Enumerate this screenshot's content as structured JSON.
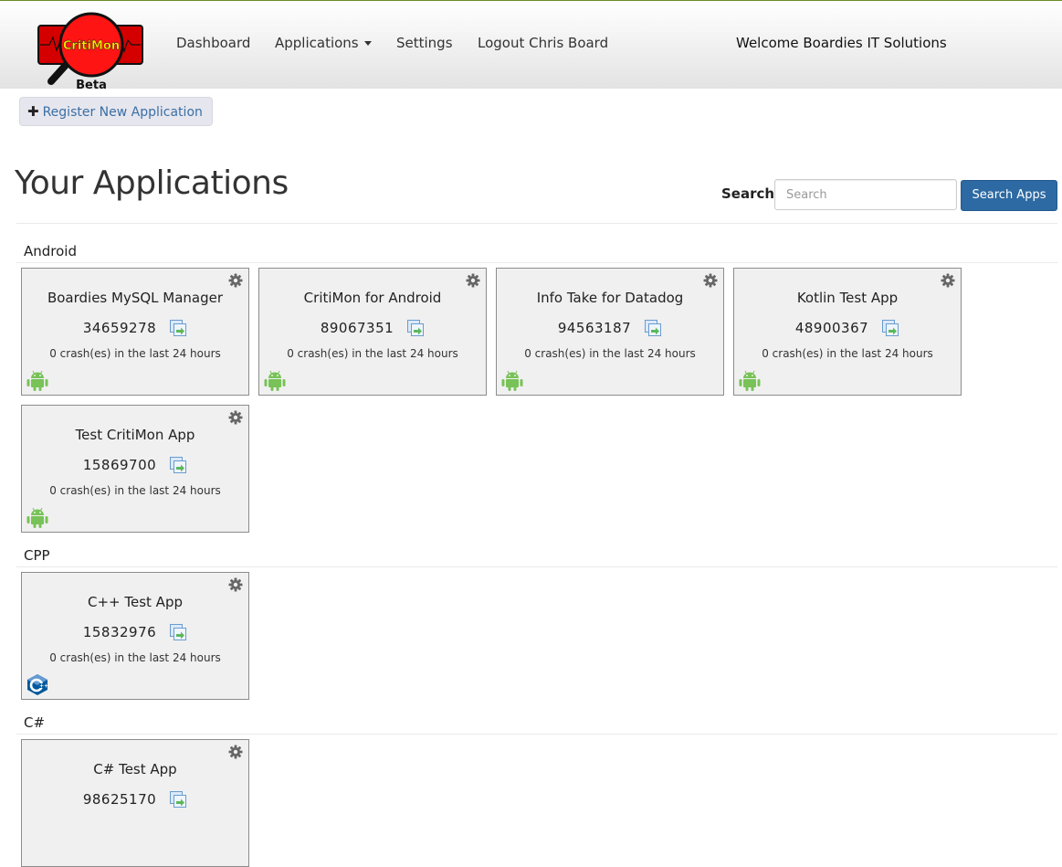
{
  "brand": {
    "logo_text": "CritiMon",
    "logo_sub": "Beta"
  },
  "nav": {
    "dashboard": "Dashboard",
    "applications": "Applications",
    "settings": "Settings",
    "logout": "Logout Chris Board",
    "welcome": "Welcome Boardies IT Solutions"
  },
  "register": {
    "label": "Register New Application"
  },
  "page": {
    "title": "Your Applications"
  },
  "search": {
    "label": "Search:",
    "placeholder": "Search",
    "button": "Search Apps"
  },
  "crash_text": "0 crash(es) in the last 24 hours",
  "sections": [
    {
      "name": "Android",
      "platform": "android-icon",
      "apps": [
        {
          "name": "Boardies MySQL Manager",
          "id": "34659278"
        },
        {
          "name": "CritiMon for Android",
          "id": "89067351"
        },
        {
          "name": "Info Take for Datadog",
          "id": "94563187"
        },
        {
          "name": "Kotlin Test App",
          "id": "48900367"
        },
        {
          "name": "Test CritiMon App",
          "id": "15869700"
        }
      ]
    },
    {
      "name": "CPP",
      "platform": "cpp-icon",
      "apps": [
        {
          "name": "C++ Test App",
          "id": "15832976"
        }
      ]
    },
    {
      "name": "C#",
      "platform": "csharp-icon",
      "apps": [
        {
          "name": "C# Test App",
          "id": "98625170"
        }
      ]
    }
  ],
  "colors": {
    "android": "#78c257",
    "cpp": "#00599c",
    "primary_button": "#2d6aa3",
    "link": "#3a6fa5"
  }
}
